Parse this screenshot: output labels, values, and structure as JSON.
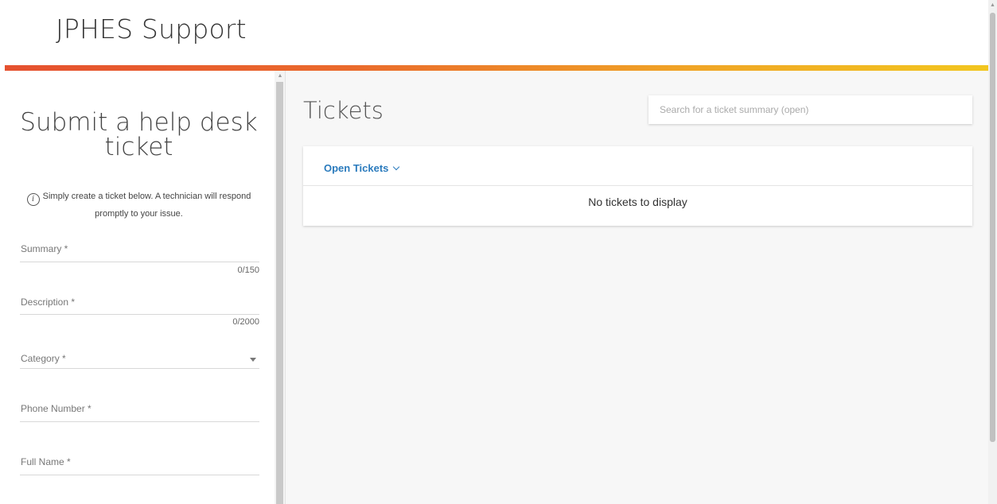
{
  "header": {
    "brand": "JPHES Support"
  },
  "form": {
    "title": "Submit a help desk ticket",
    "info_text": "Simply create a ticket below. A technician will respond promptly to your issue.",
    "fields": {
      "summary": {
        "label": "Summary *",
        "counter": "0/150"
      },
      "description": {
        "label": "Description *",
        "counter": "0/2000"
      },
      "category": {
        "label": "Category *"
      },
      "phone": {
        "label": "Phone Number *"
      },
      "full_name": {
        "label": "Full Name *"
      }
    }
  },
  "tickets": {
    "title": "Tickets",
    "search_placeholder": "Search for a ticket summary (open)",
    "filter_label": "Open Tickets",
    "empty_message": "No tickets to display"
  },
  "icons": {
    "info": "info-icon",
    "filter_chevron": "chevron-down-icon",
    "dropdown": "dropdown-arrow-icon"
  },
  "colors": {
    "accent_link": "#2b7bbd",
    "gradient_start": "#e5512f",
    "gradient_end": "#f2c61f"
  }
}
